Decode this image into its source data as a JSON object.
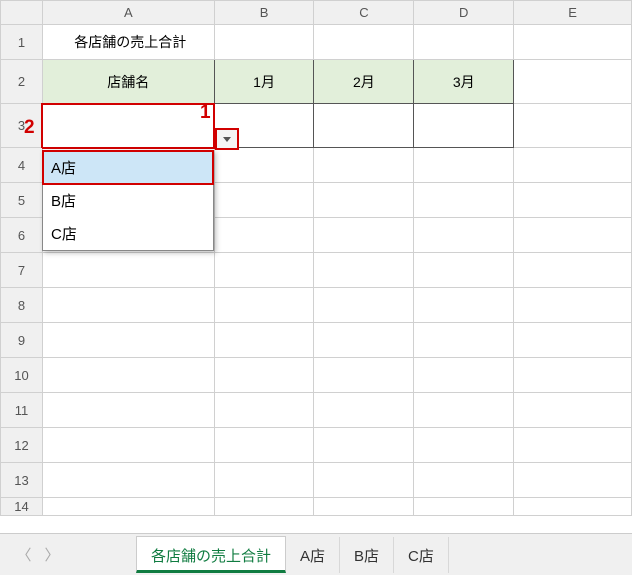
{
  "columns": [
    "A",
    "B",
    "C",
    "D",
    "E"
  ],
  "rows": [
    "1",
    "2",
    "3",
    "4",
    "5",
    "6",
    "7",
    "8",
    "9",
    "10",
    "11",
    "12",
    "13",
    "14"
  ],
  "cells": {
    "A1": "各店舗の売上合計",
    "A2": "店舗名",
    "B2": "1月",
    "C2": "2月",
    "D2": "3月"
  },
  "dropdown": {
    "items": [
      "A店",
      "B店",
      "C店"
    ],
    "selected_index": 0
  },
  "callouts": {
    "one": "1",
    "two": "2"
  },
  "tabs": {
    "items": [
      "各店舗の売上合計",
      "A店",
      "B店",
      "C店"
    ],
    "active_index": 0
  }
}
